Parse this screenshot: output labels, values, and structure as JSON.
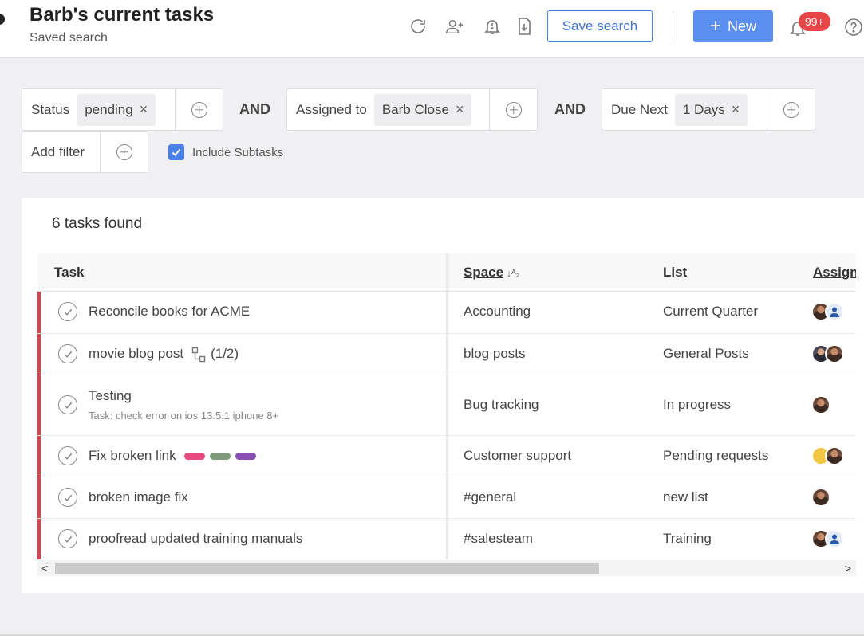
{
  "header": {
    "title": "Barb's current tasks",
    "subtitle": "Saved search",
    "icons": [
      "refresh-icon",
      "add-user-icon",
      "alarm-icon",
      "export-icon",
      "bell-icon",
      "help-icon"
    ],
    "save_search_label": "Save search",
    "new_label": "New",
    "new_plus": "+",
    "notification_count": "99+"
  },
  "filters": {
    "groups": [
      {
        "label": "Status",
        "value": "pending",
        "remove": "×"
      },
      {
        "label": "Assigned to",
        "value": "Barb Close",
        "remove": "×"
      },
      {
        "label": "Due Next",
        "value": "1 Days",
        "remove": "×"
      }
    ],
    "operators": [
      "AND",
      "AND"
    ],
    "add_filter_label": "Add filter",
    "include_subtasks_label": "Include Subtasks",
    "include_subtasks_checked": true
  },
  "results": {
    "count_text": "6  tasks found",
    "columns": {
      "task": "Task",
      "space": "Space",
      "list": "List",
      "assignee": "Assignee"
    },
    "rows": [
      {
        "task": "Reconcile books for ACME",
        "space": "Accounting",
        "list": "Current Quarter"
      },
      {
        "task": "movie blog post",
        "subtasks": "(1/2)",
        "space": "blog posts",
        "list": "General Posts"
      },
      {
        "task": "Testing",
        "note": "Task: check error on ios 13.5.1 iphone 8+",
        "space": "Bug tracking",
        "list": "In progress"
      },
      {
        "task": "Fix broken link",
        "tags": [
          "#e84a7f",
          "#7f9a7b",
          "#8a4fb3"
        ],
        "space": "Customer support",
        "list": "Pending requests"
      },
      {
        "task": "broken image fix",
        "space": "#general",
        "list": "new list"
      },
      {
        "task": "proofread updated training manuals",
        "space": "#salesteam",
        "list": "Training"
      }
    ],
    "priority_color": "#d94452"
  },
  "scrollbar": {
    "left_arrow": "<",
    "right_arrow": ">"
  },
  "colors": {
    "accent": "#5a8ff0",
    "badge": "#e54646"
  }
}
